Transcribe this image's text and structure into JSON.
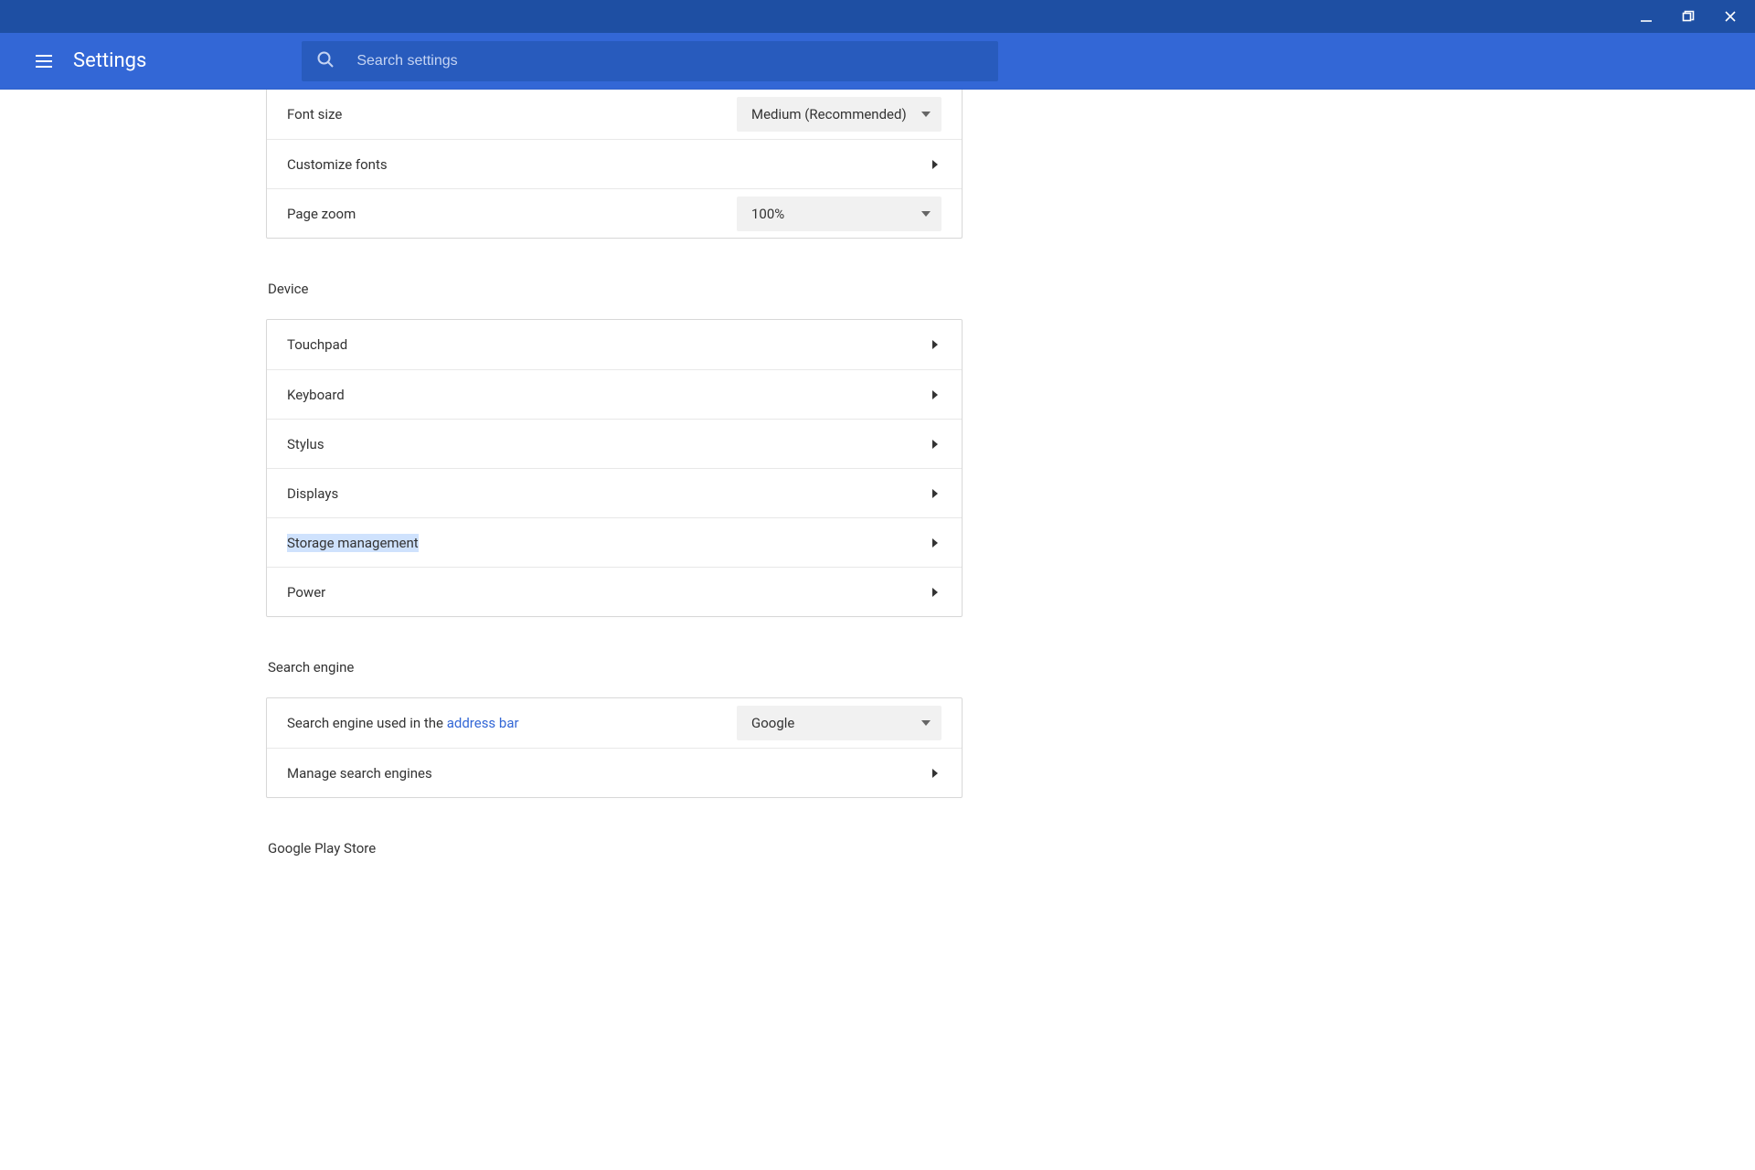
{
  "header": {
    "title": "Settings",
    "search_placeholder": "Search settings"
  },
  "appearance": {
    "font_size_label": "Font size",
    "font_size_value": "Medium (Recommended)",
    "customize_fonts": "Customize fonts",
    "page_zoom_label": "Page zoom",
    "page_zoom_value": "100%"
  },
  "device": {
    "section_title": "Device",
    "touchpad": "Touchpad",
    "keyboard": "Keyboard",
    "stylus": "Stylus",
    "displays": "Displays",
    "storage": "Storage management",
    "power": "Power"
  },
  "search_engine": {
    "section_title": "Search engine",
    "row_prefix": "Search engine used in the ",
    "row_link": "address bar",
    "value": "Google",
    "manage": "Manage search engines"
  },
  "play_store": {
    "section_title": "Google Play Store"
  }
}
